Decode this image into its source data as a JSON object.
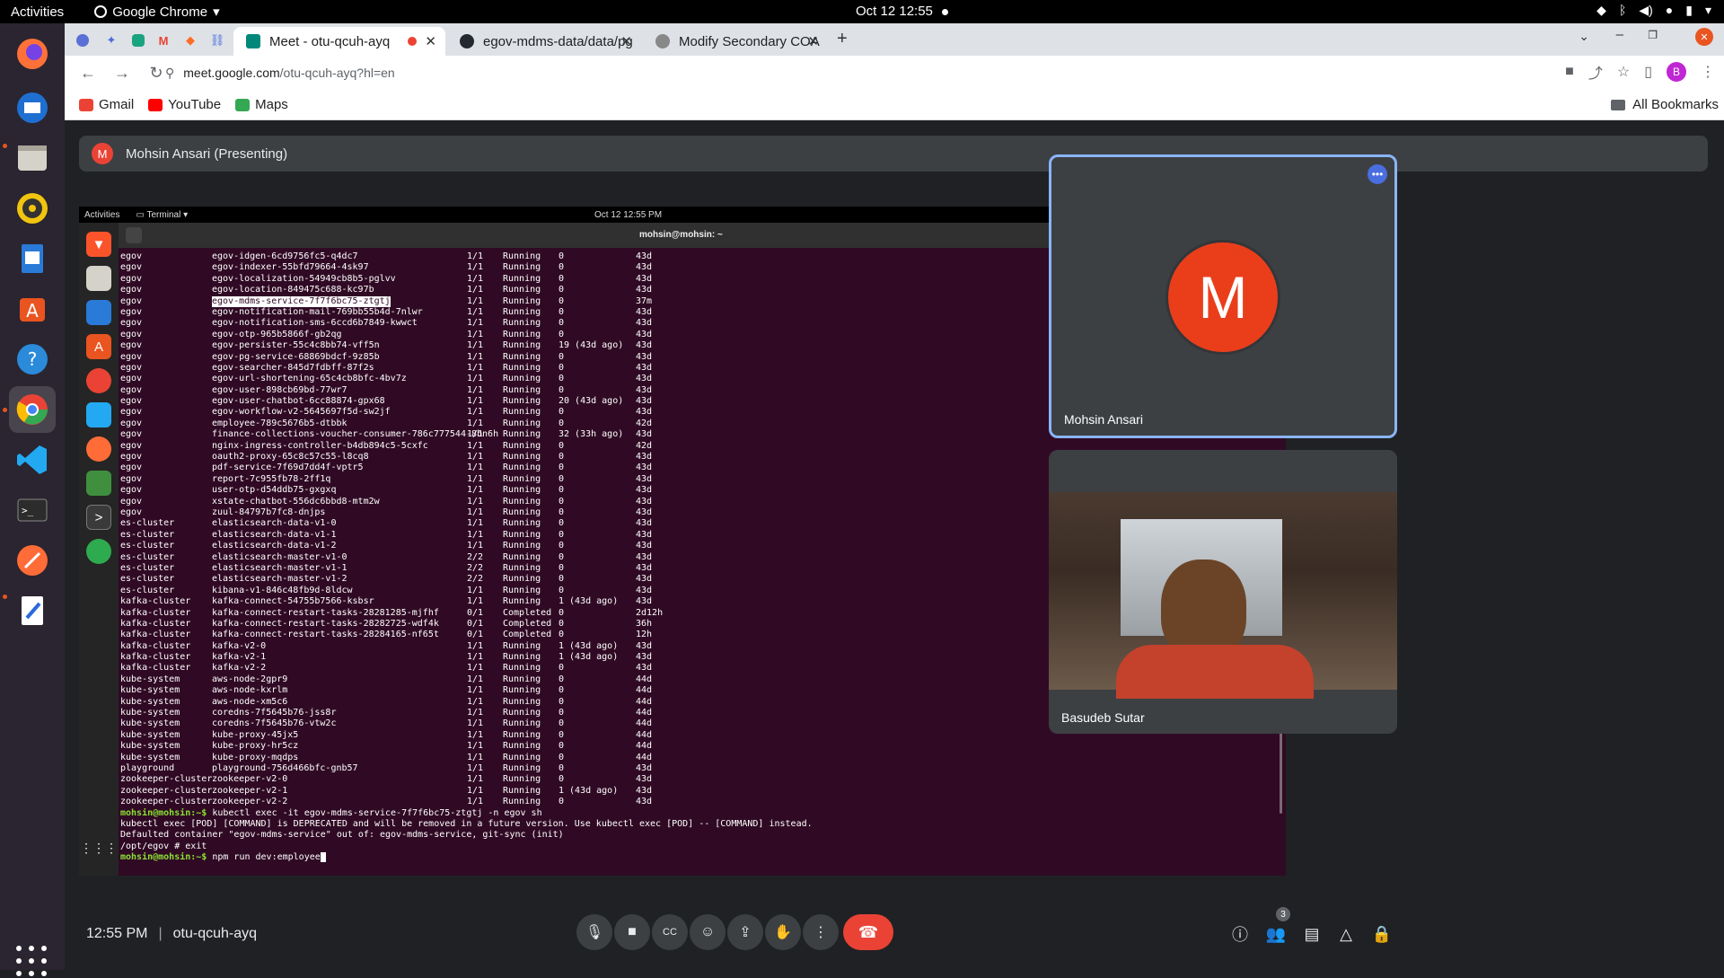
{
  "system": {
    "activities": "Activities",
    "app_name": "Google Chrome",
    "clock": "Oct 12  12:55"
  },
  "chrome": {
    "tabs": [
      {
        "label": "Meet - otu-qcuh-ayq",
        "active": true
      },
      {
        "label": "egov-mdms-data/data/pg",
        "active": false
      },
      {
        "label": "Modify Secondary COA",
        "active": false
      }
    ],
    "url_host": "meet.google.com",
    "url_path": "/otu-qcuh-ayq?hl=en",
    "profile_initial": "B",
    "bookmarks": [
      "Gmail",
      "YouTube",
      "Maps"
    ],
    "all_bookmarks": "All Bookmarks"
  },
  "meet": {
    "presenter_initial": "M",
    "presenter_label": "Mohsin Ansari (Presenting)",
    "tile1_name": "Mohsin Ansari",
    "tile1_initial": "M",
    "tile2_name": "Basudeb Sutar",
    "time": "12:55 PM",
    "meeting_code": "otu-qcuh-ayq",
    "participants_count": "3"
  },
  "shared_screen": {
    "activities": "Activities",
    "app": "Terminal",
    "clock": "Oct 12  12:55 PM",
    "window_title": "mohsin@mohsin: ~",
    "pods": [
      [
        "egov",
        "egov-idgen-6cd9756fc5-q4dc7",
        "1/1",
        "Running",
        "0",
        "43d"
      ],
      [
        "egov",
        "egov-indexer-55bfd79664-4sk97",
        "1/1",
        "Running",
        "0",
        "43d"
      ],
      [
        "egov",
        "egov-localization-54949cb8b5-pglvv",
        "1/1",
        "Running",
        "0",
        "43d"
      ],
      [
        "egov",
        "egov-location-849475c688-kc97b",
        "1/1",
        "Running",
        "0",
        "43d"
      ],
      [
        "egov",
        "egov-mdms-service-7f7f6bc75-ztgtj",
        "1/1",
        "Running",
        "0",
        "37m"
      ],
      [
        "egov",
        "egov-notification-mail-769bb55b4d-7nlwr",
        "1/1",
        "Running",
        "0",
        "43d"
      ],
      [
        "egov",
        "egov-notification-sms-6ccd6b7849-kwwct",
        "1/1",
        "Running",
        "0",
        "43d"
      ],
      [
        "egov",
        "egov-otp-965b5866f-gb2qg",
        "1/1",
        "Running",
        "0",
        "43d"
      ],
      [
        "egov",
        "egov-persister-55c4c8bb74-vff5n",
        "1/1",
        "Running",
        "19 (43d ago)",
        "43d"
      ],
      [
        "egov",
        "egov-pg-service-68869bdcf-9z85b",
        "1/1",
        "Running",
        "0",
        "43d"
      ],
      [
        "egov",
        "egov-searcher-845d7fdbff-87f2s",
        "1/1",
        "Running",
        "0",
        "43d"
      ],
      [
        "egov",
        "egov-url-shortening-65c4cb8bfc-4bv7z",
        "1/1",
        "Running",
        "0",
        "43d"
      ],
      [
        "egov",
        "egov-user-898cb69bd-77wr7",
        "1/1",
        "Running",
        "0",
        "43d"
      ],
      [
        "egov",
        "egov-user-chatbot-6cc88874-gpx68",
        "1/1",
        "Running",
        "20 (43d ago)",
        "43d"
      ],
      [
        "egov",
        "egov-workflow-v2-5645697f5d-sw2jf",
        "1/1",
        "Running",
        "0",
        "43d"
      ],
      [
        "egov",
        "employee-789c5676b5-dtbbk",
        "1/1",
        "Running",
        "0",
        "42d"
      ],
      [
        "egov",
        "finance-collections-voucher-consumer-786c777544-8bn6h",
        "1/1",
        "Running",
        "32 (33h ago)",
        "43d"
      ],
      [
        "egov",
        "nginx-ingress-controller-b4db894c5-5cxfc",
        "1/1",
        "Running",
        "0",
        "42d"
      ],
      [
        "egov",
        "oauth2-proxy-65c8c57c55-l8cq8",
        "1/1",
        "Running",
        "0",
        "43d"
      ],
      [
        "egov",
        "pdf-service-7f69d7dd4f-vptr5",
        "1/1",
        "Running",
        "0",
        "43d"
      ],
      [
        "egov",
        "report-7c955fb78-2ff1q",
        "1/1",
        "Running",
        "0",
        "43d"
      ],
      [
        "egov",
        "user-otp-d54ddb75-gxgxq",
        "1/1",
        "Running",
        "0",
        "43d"
      ],
      [
        "egov",
        "xstate-chatbot-556dc6bbd8-mtm2w",
        "1/1",
        "Running",
        "0",
        "43d"
      ],
      [
        "egov",
        "zuul-84797b7fc8-dnjps",
        "1/1",
        "Running",
        "0",
        "43d"
      ],
      [
        "es-cluster",
        "elasticsearch-data-v1-0",
        "1/1",
        "Running",
        "0",
        "43d"
      ],
      [
        "es-cluster",
        "elasticsearch-data-v1-1",
        "1/1",
        "Running",
        "0",
        "43d"
      ],
      [
        "es-cluster",
        "elasticsearch-data-v1-2",
        "1/1",
        "Running",
        "0",
        "43d"
      ],
      [
        "es-cluster",
        "elasticsearch-master-v1-0",
        "2/2",
        "Running",
        "0",
        "43d"
      ],
      [
        "es-cluster",
        "elasticsearch-master-v1-1",
        "2/2",
        "Running",
        "0",
        "43d"
      ],
      [
        "es-cluster",
        "elasticsearch-master-v1-2",
        "2/2",
        "Running",
        "0",
        "43d"
      ],
      [
        "es-cluster",
        "kibana-v1-846c48fb9d-8ldcw",
        "1/1",
        "Running",
        "0",
        "43d"
      ],
      [
        "kafka-cluster",
        "kafka-connect-54755b7566-ksbsr",
        "1/1",
        "Running",
        "1 (43d ago)",
        "43d"
      ],
      [
        "kafka-cluster",
        "kafka-connect-restart-tasks-28281285-mjfhf",
        "0/1",
        "Completed",
        "0",
        "2d12h"
      ],
      [
        "kafka-cluster",
        "kafka-connect-restart-tasks-28282725-wdf4k",
        "0/1",
        "Completed",
        "0",
        "36h"
      ],
      [
        "kafka-cluster",
        "kafka-connect-restart-tasks-28284165-nf65t",
        "0/1",
        "Completed",
        "0",
        "12h"
      ],
      [
        "kafka-cluster",
        "kafka-v2-0",
        "1/1",
        "Running",
        "1 (43d ago)",
        "43d"
      ],
      [
        "kafka-cluster",
        "kafka-v2-1",
        "1/1",
        "Running",
        "1 (43d ago)",
        "43d"
      ],
      [
        "kafka-cluster",
        "kafka-v2-2",
        "1/1",
        "Running",
        "0",
        "43d"
      ],
      [
        "kube-system",
        "aws-node-2gpr9",
        "1/1",
        "Running",
        "0",
        "44d"
      ],
      [
        "kube-system",
        "aws-node-kxrlm",
        "1/1",
        "Running",
        "0",
        "44d"
      ],
      [
        "kube-system",
        "aws-node-xm5c6",
        "1/1",
        "Running",
        "0",
        "44d"
      ],
      [
        "kube-system",
        "coredns-7f5645b76-jss8r",
        "1/1",
        "Running",
        "0",
        "44d"
      ],
      [
        "kube-system",
        "coredns-7f5645b76-vtw2c",
        "1/1",
        "Running",
        "0",
        "44d"
      ],
      [
        "kube-system",
        "kube-proxy-45jx5",
        "1/1",
        "Running",
        "0",
        "44d"
      ],
      [
        "kube-system",
        "kube-proxy-hr5cz",
        "1/1",
        "Running",
        "0",
        "44d"
      ],
      [
        "kube-system",
        "kube-proxy-mqdps",
        "1/1",
        "Running",
        "0",
        "44d"
      ],
      [
        "playground",
        "playground-756d466bfc-gnb57",
        "1/1",
        "Running",
        "0",
        "43d"
      ],
      [
        "zookeeper-cluster",
        "zookeeper-v2-0",
        "1/1",
        "Running",
        "0",
        "43d"
      ],
      [
        "zookeeper-cluster",
        "zookeeper-v2-1",
        "1/1",
        "Running",
        "1 (43d ago)",
        "43d"
      ],
      [
        "zookeeper-cluster",
        "zookeeper-v2-2",
        "1/1",
        "Running",
        "0",
        "43d"
      ]
    ],
    "highlighted_pod": "egov-mdms-service-7f7f6bc75-ztgtj",
    "prompt": "mohsin@mohsin:~$",
    "cmd1": " kubectl exec -it egov-mdms-service-7f7f6bc75-ztgtj -n egov sh",
    "out1": "kubectl exec [POD] [COMMAND] is DEPRECATED and will be removed in a future version. Use kubectl exec [POD] -- [COMMAND] instead.",
    "out2": "Defaulted container \"egov-mdms-service\" out of: egov-mdms-service, git-sync (init)",
    "out3": "/opt/egov # exit",
    "cmd2": " npm run dev:employee"
  }
}
